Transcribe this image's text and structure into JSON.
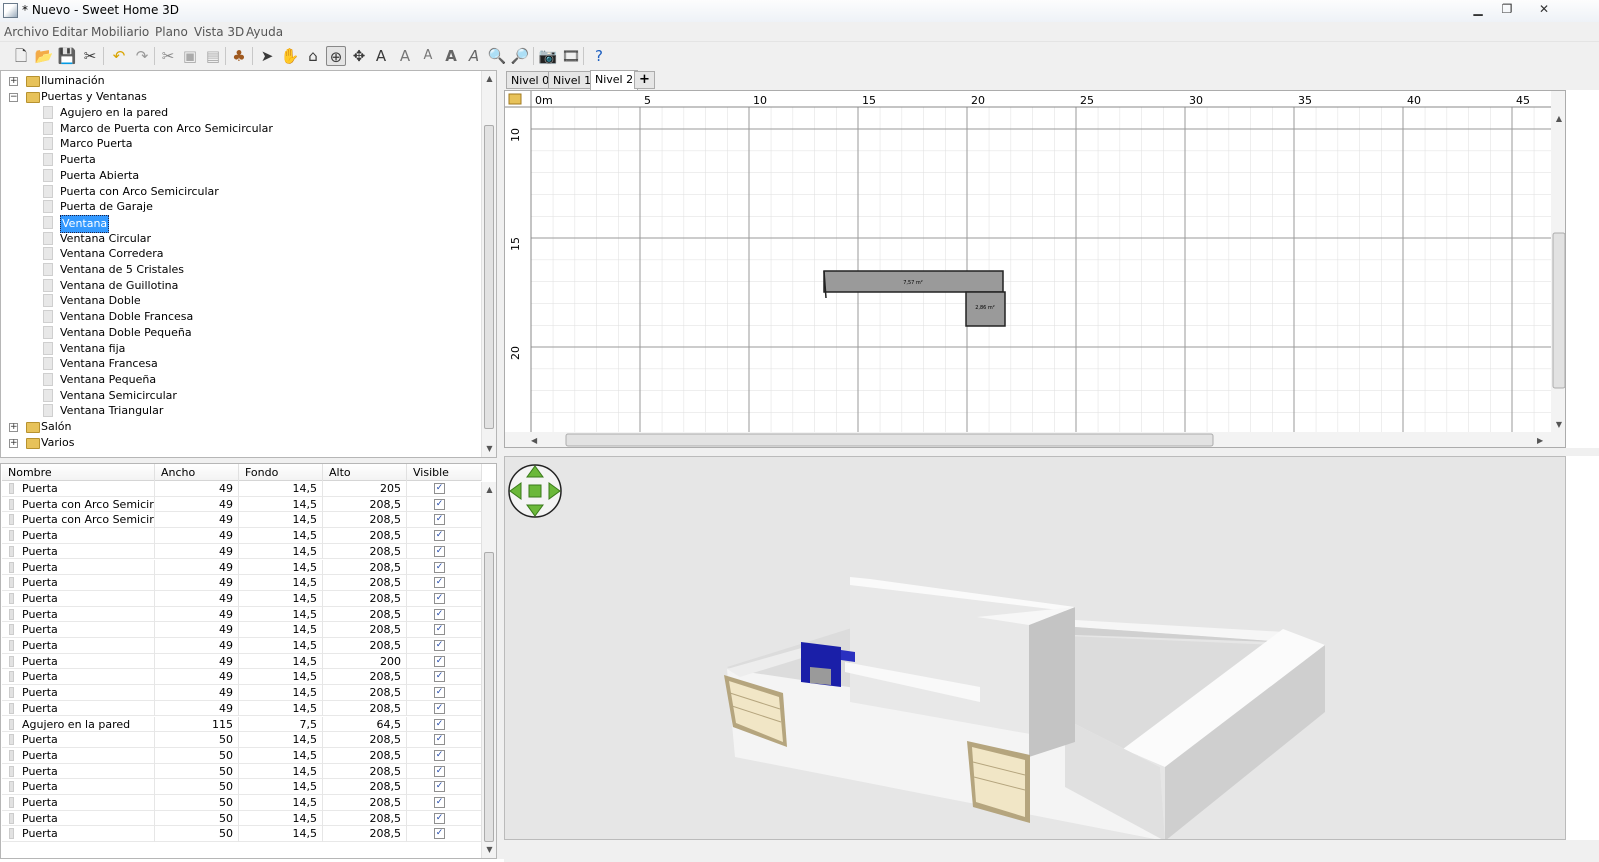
{
  "window": {
    "title": "* Nuevo - Sweet Home 3D",
    "controls": [
      "minimize",
      "restore",
      "close"
    ]
  },
  "menu": [
    "Archivo",
    "Editar",
    "Mobiliario",
    "Plano",
    "Vista 3D",
    "Ayuda"
  ],
  "toolbar": [
    "new-icon",
    "open-icon",
    "save-icon",
    "preferences-icon",
    "undo-icon",
    "redo-icon",
    "cut-icon",
    "copy-icon",
    "paste-icon",
    "add-furniture-icon",
    "select-icon",
    "pan-icon",
    "create-walls-icon",
    "create-rooms-icon",
    "create-dimensions-icon",
    "add-text-icon",
    "increase-text-icon",
    "decrease-text-icon",
    "bold-text-icon",
    "italic-text-icon",
    "zoom-in-icon",
    "zoom-out-icon",
    "create-photo-icon",
    "create-video-icon",
    "help-icon"
  ],
  "catalog": {
    "categories": [
      {
        "label": "Iluminación",
        "expanded": false
      },
      {
        "label": "Puertas y Ventanas",
        "expanded": true
      }
    ],
    "items": [
      "Agujero en la pared",
      "Marco de Puerta con Arco Semicircular",
      "Marco Puerta",
      "Puerta",
      "Puerta Abierta",
      "Puerta con Arco Semicircular",
      "Puerta de Garaje",
      "Ventana",
      "Ventana Circular",
      "Ventana Corredera",
      "Ventana de 5 Cristales",
      "Ventana de Guillotina",
      "Ventana Doble",
      "Ventana Doble Francesa",
      "Ventana Doble Pequeña",
      "Ventana fija",
      "Ventana Francesa",
      "Ventana Pequeña",
      "Ventana Semicircular",
      "Ventana Triangular"
    ],
    "selected": "Ventana",
    "trailing": [
      "Salón",
      "Varios"
    ]
  },
  "furniture": {
    "columns": [
      "Nombre",
      "Ancho",
      "Fondo",
      "Alto",
      "Visible"
    ],
    "rows": [
      [
        "Puerta",
        "49",
        "14,5",
        "205",
        true
      ],
      [
        "Puerta con Arco Semicirc...",
        "49",
        "14,5",
        "208,5",
        true
      ],
      [
        "Puerta con Arco Semicirc...",
        "49",
        "14,5",
        "208,5",
        true
      ],
      [
        "Puerta",
        "49",
        "14,5",
        "208,5",
        true
      ],
      [
        "Puerta",
        "49",
        "14,5",
        "208,5",
        true
      ],
      [
        "Puerta",
        "49",
        "14,5",
        "208,5",
        true
      ],
      [
        "Puerta",
        "49",
        "14,5",
        "208,5",
        true
      ],
      [
        "Puerta",
        "49",
        "14,5",
        "208,5",
        true
      ],
      [
        "Puerta",
        "49",
        "14,5",
        "208,5",
        true
      ],
      [
        "Puerta",
        "49",
        "14,5",
        "208,5",
        true
      ],
      [
        "Puerta",
        "49",
        "14,5",
        "208,5",
        true
      ],
      [
        "Puerta",
        "49",
        "14,5",
        "200",
        true
      ],
      [
        "Puerta",
        "49",
        "14,5",
        "208,5",
        true
      ],
      [
        "Puerta",
        "49",
        "14,5",
        "208,5",
        true
      ],
      [
        "Puerta",
        "49",
        "14,5",
        "208,5",
        true
      ],
      [
        "Agujero en la pared",
        "115",
        "7,5",
        "64,5",
        true
      ],
      [
        "Puerta",
        "50",
        "14,5",
        "208,5",
        true
      ],
      [
        "Puerta",
        "50",
        "14,5",
        "208,5",
        true
      ],
      [
        "Puerta",
        "50",
        "14,5",
        "208,5",
        true
      ],
      [
        "Puerta",
        "50",
        "14,5",
        "208,5",
        true
      ],
      [
        "Puerta",
        "50",
        "14,5",
        "208,5",
        true
      ],
      [
        "Puerta",
        "50",
        "14,5",
        "208,5",
        true
      ],
      [
        "Puerta",
        "50",
        "14,5",
        "208,5",
        true
      ]
    ]
  },
  "levels": {
    "tabs": [
      "Nivel 0",
      "Nivel 1",
      "Nivel 2"
    ],
    "selected": "Nivel 2",
    "add_label": "+"
  },
  "plan": {
    "ruler_top": [
      "0m",
      "5",
      "10",
      "15",
      "20",
      "25",
      "30",
      "35",
      "40",
      "45"
    ],
    "ruler_left": [
      "10",
      "15",
      "20"
    ],
    "rooms": [
      {
        "area": "7,57 m²"
      },
      {
        "area": "2,86 m²"
      }
    ]
  },
  "view3d": {
    "navigator": "navigation-arrows-icon"
  },
  "colors": {
    "wall": "#f4f4f4",
    "window_blue": "#1a1fa8",
    "garage_door": "#f1e6c6",
    "room_fill": "#9a9a9a"
  }
}
